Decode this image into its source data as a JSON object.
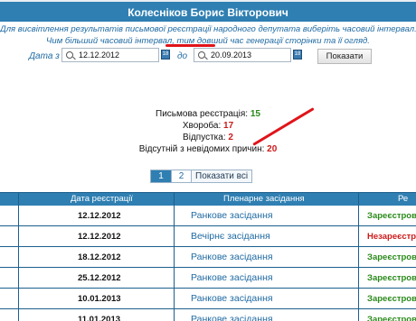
{
  "header": {
    "title": "Колесніков Борис Вікторович"
  },
  "hint": {
    "line1_a": "Для висвітлення результатів ",
    "line1_link": "письмової реєстрації",
    "line1_b": " народного депутата виберіть часовий інтервал.",
    "line2": "Чим більший часовий інтервал, тим довший час генерації сторінки та її огляд."
  },
  "filter": {
    "from_label": "Дата з",
    "from_value": "12.12.2012",
    "to_label": "до",
    "to_value": "20.09.2013",
    "show_label": "Показати"
  },
  "stats": {
    "written_label": "Письмова реєстрація:",
    "written_value": "15",
    "sick_label": "Хвороба:",
    "sick_value": "17",
    "trip_label": "Відпустка:",
    "trip_value": "2",
    "absent_label": "Відсутній з невідомих причин:",
    "absent_value": "20"
  },
  "pager": {
    "page1": "1",
    "page2": "2",
    "show_all": "Показати всі"
  },
  "table": {
    "col_date": "Дата реєстрації",
    "col_session": "Пленарне засідання",
    "col_status": "Ре",
    "rows": [
      {
        "date": "12.12.2012",
        "session": "Ранкове засідання",
        "status": "Зареєстров",
        "ok": true
      },
      {
        "date": "12.12.2012",
        "session": "Вечірнє засідання",
        "status": "Незареєстров",
        "ok": false
      },
      {
        "date": "18.12.2012",
        "session": "Ранкове засідання",
        "status": "Зареєстров",
        "ok": true
      },
      {
        "date": "25.12.2012",
        "session": "Ранкове засідання",
        "status": "Зареєстров",
        "ok": true
      },
      {
        "date": "10.01.2013",
        "session": "Ранкове засідання",
        "status": "Зареєстров",
        "ok": true
      },
      {
        "date": "11.01.2013",
        "session": "Ранкове засідання",
        "status": "Зареєстров",
        "ok": true
      }
    ]
  },
  "colors": {
    "brand": "#2f7fb2",
    "ok": "#2a8a1a",
    "bad": "#cc1a1a",
    "annotation": "#e0141a"
  }
}
